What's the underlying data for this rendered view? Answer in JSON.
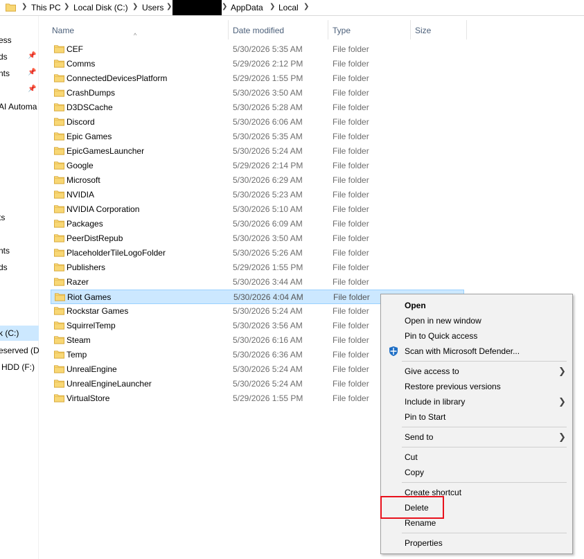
{
  "breadcrumb": {
    "items": [
      "This PC",
      "Local Disk (C:)",
      "Users",
      "AppData",
      "Local"
    ]
  },
  "nav": {
    "items": [
      {
        "label": "ess",
        "pinned": false
      },
      {
        "label": "ds",
        "pinned": true
      },
      {
        "label": "nts",
        "pinned": true
      },
      {
        "label": "",
        "pinned": true
      },
      {
        "label": "AI Automa",
        "pinned": false
      },
      {
        "label": "ts",
        "pinned": false
      },
      {
        "label": "nts",
        "pinned": false
      },
      {
        "label": "ds",
        "pinned": false
      },
      {
        "label": "k (C:)",
        "pinned": false
      },
      {
        "label": "eserved (D",
        "pinned": false
      },
      {
        "label": "HDD (F:)",
        "pinned": false
      }
    ]
  },
  "columns": {
    "name": "Name",
    "date": "Date modified",
    "type": "Type",
    "size": "Size"
  },
  "files": [
    {
      "name": "CEF",
      "date": "5/30/2026 5:35 AM",
      "type": "File folder"
    },
    {
      "name": "Comms",
      "date": "5/29/2026 2:12 PM",
      "type": "File folder"
    },
    {
      "name": "ConnectedDevicesPlatform",
      "date": "5/29/2026 1:55 PM",
      "type": "File folder"
    },
    {
      "name": "CrashDumps",
      "date": "5/30/2026 3:50 AM",
      "type": "File folder"
    },
    {
      "name": "D3DSCache",
      "date": "5/30/2026 5:28 AM",
      "type": "File folder"
    },
    {
      "name": "Discord",
      "date": "5/30/2026 6:06 AM",
      "type": "File folder"
    },
    {
      "name": "Epic Games",
      "date": "5/30/2026 5:35 AM",
      "type": "File folder"
    },
    {
      "name": "EpicGamesLauncher",
      "date": "5/30/2026 5:24 AM",
      "type": "File folder"
    },
    {
      "name": "Google",
      "date": "5/29/2026 2:14 PM",
      "type": "File folder"
    },
    {
      "name": "Microsoft",
      "date": "5/30/2026 6:29 AM",
      "type": "File folder"
    },
    {
      "name": "NVIDIA",
      "date": "5/30/2026 5:23 AM",
      "type": "File folder"
    },
    {
      "name": "NVIDIA Corporation",
      "date": "5/30/2026 5:10 AM",
      "type": "File folder"
    },
    {
      "name": "Packages",
      "date": "5/30/2026 6:09 AM",
      "type": "File folder"
    },
    {
      "name": "PeerDistRepub",
      "date": "5/30/2026 3:50 AM",
      "type": "File folder"
    },
    {
      "name": "PlaceholderTileLogoFolder",
      "date": "5/30/2026 5:26 AM",
      "type": "File folder"
    },
    {
      "name": "Publishers",
      "date": "5/29/2026 1:55 PM",
      "type": "File folder"
    },
    {
      "name": "Razer",
      "date": "5/30/2026 3:44 AM",
      "type": "File folder"
    },
    {
      "name": "Riot Games",
      "date": "5/30/2026 4:04 AM",
      "type": "File folder",
      "selected": true
    },
    {
      "name": "Rockstar Games",
      "date": "5/30/2026 5:24 AM",
      "type": "File folder"
    },
    {
      "name": "SquirrelTemp",
      "date": "5/30/2026 3:56 AM",
      "type": "File folder"
    },
    {
      "name": "Steam",
      "date": "5/30/2026 6:16 AM",
      "type": "File folder"
    },
    {
      "name": "Temp",
      "date": "5/30/2026 6:36 AM",
      "type": "File folder"
    },
    {
      "name": "UnrealEngine",
      "date": "5/30/2026 5:24 AM",
      "type": "File folder"
    },
    {
      "name": "UnrealEngineLauncher",
      "date": "5/30/2026 5:24 AM",
      "type": "File folder"
    },
    {
      "name": "VirtualStore",
      "date": "5/29/2026 1:55 PM",
      "type": "File folder"
    }
  ],
  "context_menu": {
    "open": "Open",
    "open_new_window": "Open in new window",
    "pin_quick_access": "Pin to Quick access",
    "scan_defender": "Scan with Microsoft Defender...",
    "give_access": "Give access to",
    "restore_versions": "Restore previous versions",
    "include_library": "Include in library",
    "pin_start": "Pin to Start",
    "send_to": "Send to",
    "cut": "Cut",
    "copy": "Copy",
    "create_shortcut": "Create shortcut",
    "delete": "Delete",
    "rename": "Rename",
    "properties": "Properties"
  },
  "colors": {
    "selection": "#cce8ff",
    "highlight_box": "#e8111c",
    "folder": "#f8d775"
  }
}
